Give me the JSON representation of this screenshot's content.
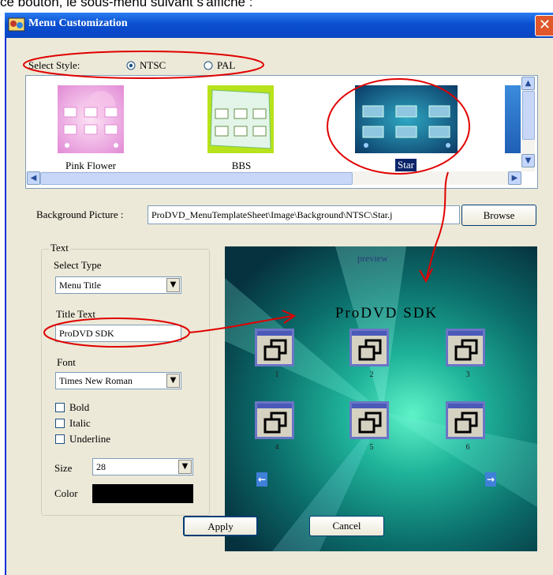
{
  "caption": "ce bouton, le sous-menu suivant s'affiche :",
  "window": {
    "title": "Menu Customization",
    "close": "✕"
  },
  "style": {
    "label": "Select Style:",
    "opt1": "NTSC",
    "opt2": "PAL",
    "selected": "NTSC"
  },
  "templates": [
    {
      "label": "Pink Flower",
      "selected": false
    },
    {
      "label": "BBS",
      "selected": false
    },
    {
      "label": "Star",
      "selected": true
    }
  ],
  "background": {
    "label": "Background Picture :",
    "value": "ProDVD_MenuTemplateSheet\\Image\\Background\\NTSC\\Star.j",
    "browse": "Browse"
  },
  "text_group": {
    "legend": "Text",
    "select_type_label": "Select Type",
    "select_type_value": "Menu Title",
    "title_text_label": "Title Text",
    "title_text_value": "ProDVD SDK",
    "font_label": "Font",
    "font_value": "Times New Roman",
    "bold": "Bold",
    "italic": "Italic",
    "underline": "Underline",
    "size_label": "Size",
    "size_value": "28",
    "color_label": "Color",
    "color_value": "#000000"
  },
  "preview": {
    "label": "preview",
    "title": "ProDVD SDK",
    "numbers": [
      "1",
      "2",
      "3",
      "4",
      "5",
      "6"
    ]
  },
  "buttons": {
    "apply": "Apply",
    "cancel": "Cancel"
  },
  "colors": {
    "annotation": "#e00000",
    "titlebar": "#0a4fd0"
  }
}
